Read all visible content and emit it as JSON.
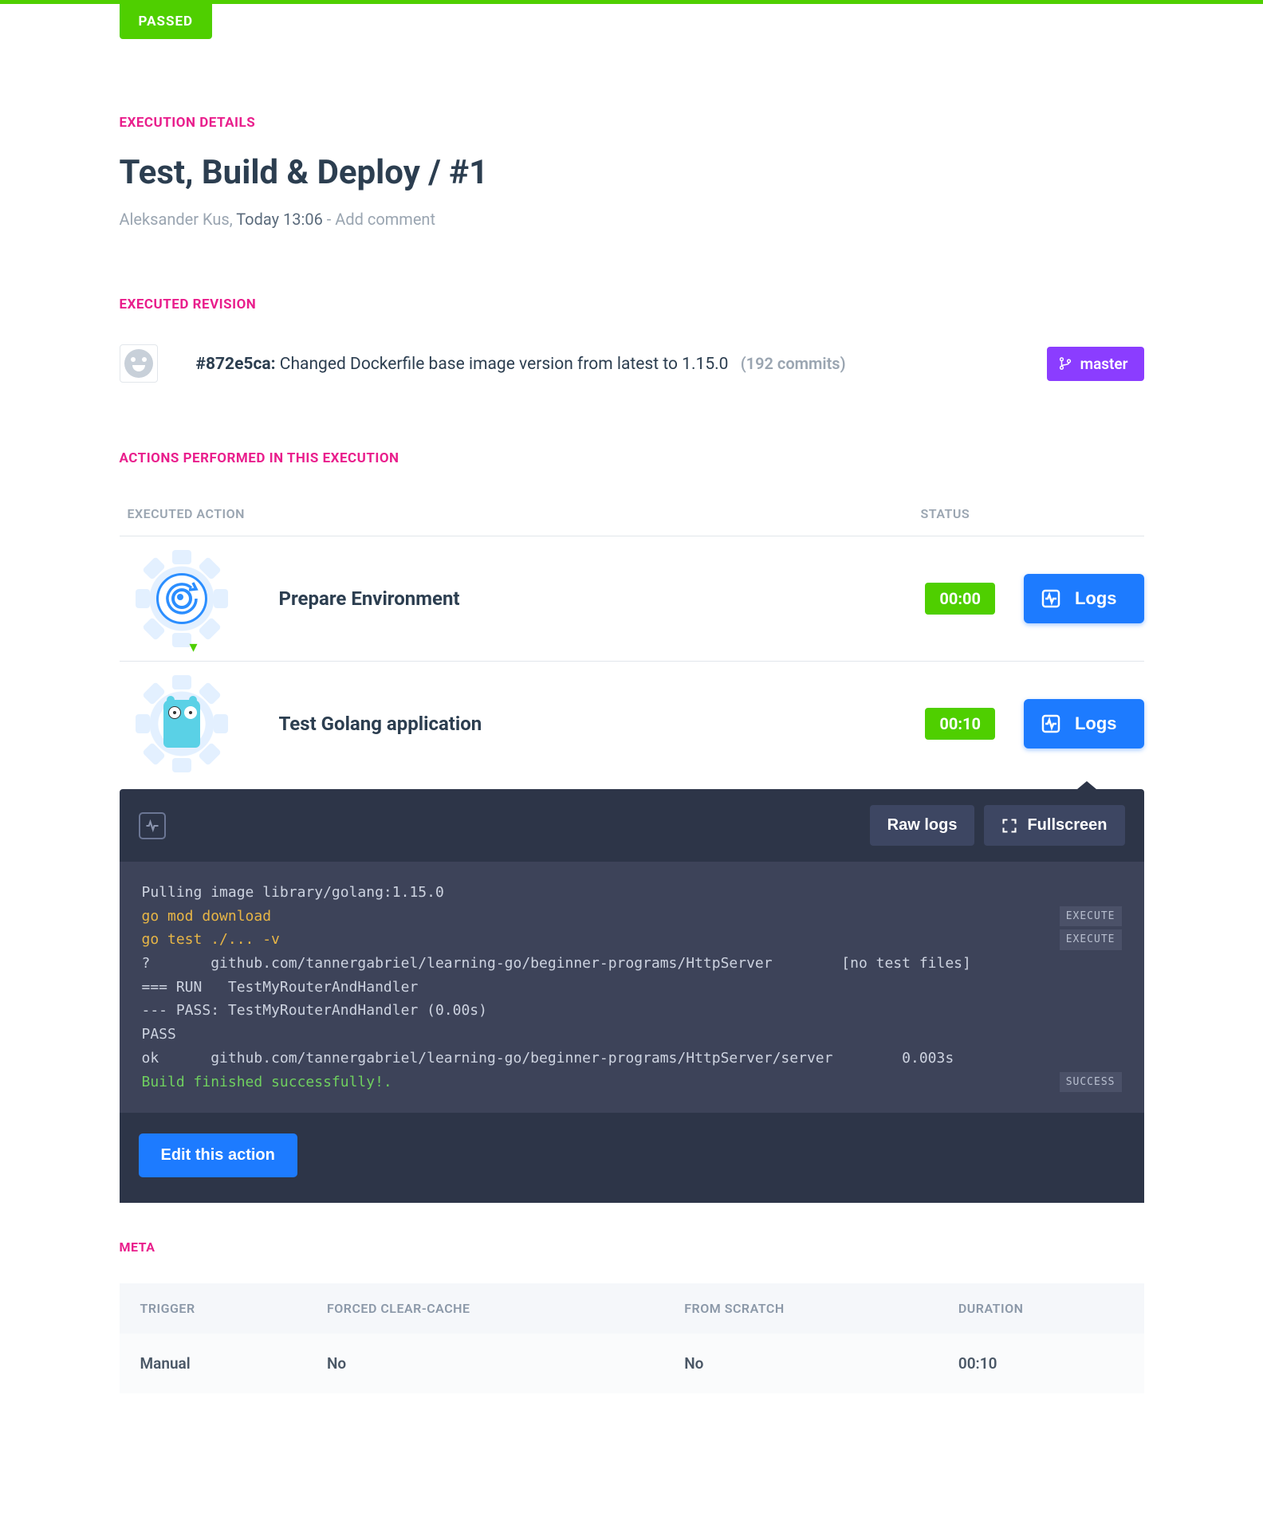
{
  "status_badge": "PASSED",
  "sections": {
    "execution_details": "EXECUTION DETAILS",
    "executed_revision": "EXECUTED REVISION",
    "actions": "ACTIONS PERFORMED IN THIS EXECUTION",
    "meta": "META"
  },
  "title": "Test, Build & Deploy / #1",
  "author": "Aleksander Kus",
  "timestamp": "Today 13:06",
  "add_comment": "Add comment",
  "revision": {
    "hash": "#872e5ca:",
    "message": "Changed Dockerfile base image version from latest to 1.15.0",
    "commit_count": "(192 commits)",
    "branch": "master"
  },
  "actions_table": {
    "header_action": "EXECUTED ACTION",
    "header_status": "STATUS",
    "rows": [
      {
        "name": "Prepare Environment",
        "duration": "00:00",
        "logs_label": "Logs"
      },
      {
        "name": "Test Golang application",
        "duration": "00:10",
        "logs_label": "Logs"
      }
    ]
  },
  "console": {
    "raw_logs": "Raw logs",
    "fullscreen": "Fullscreen",
    "edit_action": "Edit this action",
    "lines": [
      {
        "text": "Pulling image library/golang:1.15.0",
        "cls": ""
      },
      {
        "text": "go mod download",
        "cls": "log-yellow",
        "tag": "EXECUTE"
      },
      {
        "text": "go test ./... -v",
        "cls": "log-yellow",
        "tag": "EXECUTE"
      },
      {
        "text": "?       github.com/tannergabriel/learning-go/beginner-programs/HttpServer        [no test files]",
        "cls": ""
      },
      {
        "text": "=== RUN   TestMyRouterAndHandler",
        "cls": ""
      },
      {
        "text": "--- PASS: TestMyRouterAndHandler (0.00s)",
        "cls": ""
      },
      {
        "text": "PASS",
        "cls": ""
      },
      {
        "text": "ok      github.com/tannergabriel/learning-go/beginner-programs/HttpServer/server        0.003s",
        "cls": ""
      },
      {
        "text": "Build finished successfully!.",
        "cls": "log-green",
        "tag": "SUCCESS"
      }
    ]
  },
  "meta": {
    "headers": {
      "trigger": "TRIGGER",
      "clear_cache": "FORCED CLEAR-CACHE",
      "from_scratch": "FROM SCRATCH",
      "duration": "DURATION"
    },
    "values": {
      "trigger": "Manual",
      "clear_cache": "No",
      "from_scratch": "No",
      "duration": "00:10"
    }
  }
}
